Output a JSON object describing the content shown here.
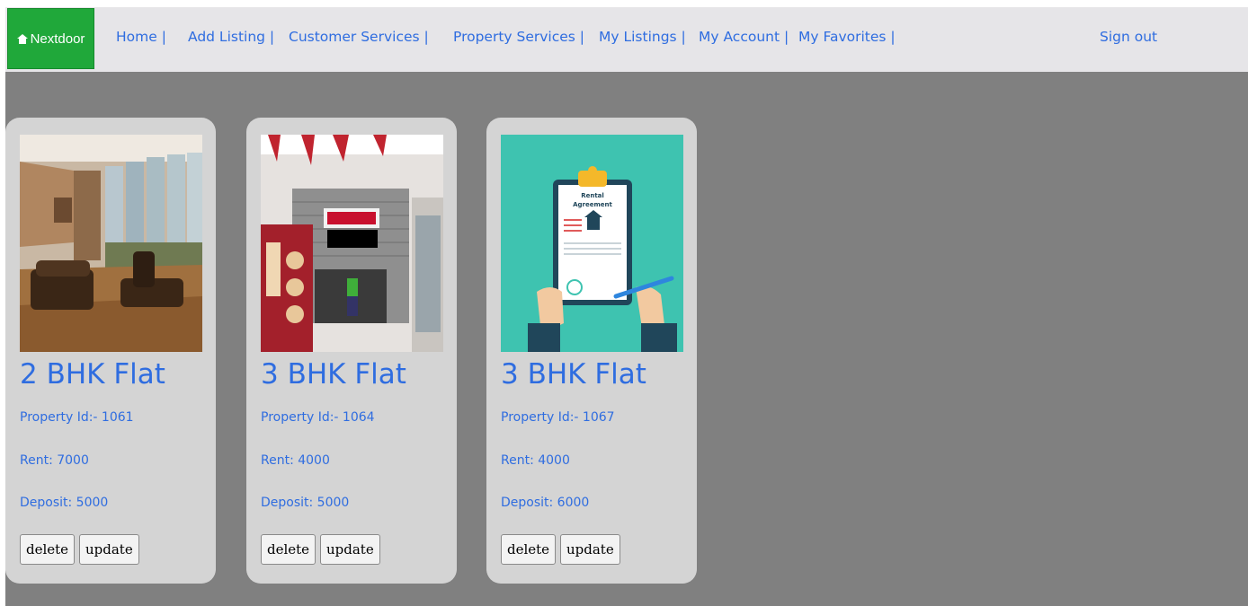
{
  "colors": {
    "page_background": "#808080",
    "navbar_background": "#e6e5e8",
    "brand_background": "#20a83a",
    "link_color": "#2f6de0",
    "card_background": "#d4d4d4"
  },
  "navbar": {
    "brand": {
      "icon": "home-icon",
      "label": "Nextdoor"
    },
    "links": [
      "Home |",
      "Add Listing |",
      "Customer Services |",
      "Property Services |",
      "My Listings |",
      "My Account |",
      "My Favorites |"
    ],
    "sign_out": "Sign out"
  },
  "listings": [
    {
      "image": "living-room-photo",
      "title": "2 BHK Flat",
      "property_id": "Property Id:- 1061",
      "rent": "Rent: 7000",
      "deposit": "Deposit: 5000",
      "delete_label": "delete",
      "update_label": "update"
    },
    {
      "image": "storefront-for-rent-photo",
      "title": "3 BHK Flat",
      "property_id": "Property Id:- 1064",
      "rent": "Rent: 4000",
      "deposit": "Deposit: 5000",
      "delete_label": "delete",
      "update_label": "update"
    },
    {
      "image": "rental-agreement-illustration",
      "title": "3 BHK Flat",
      "property_id": "Property Id:- 1067",
      "rent": "Rent: 4000",
      "deposit": "Deposit: 6000",
      "delete_label": "delete",
      "update_label": "update",
      "image_text": [
        "Rental",
        "Agreement"
      ]
    }
  ]
}
